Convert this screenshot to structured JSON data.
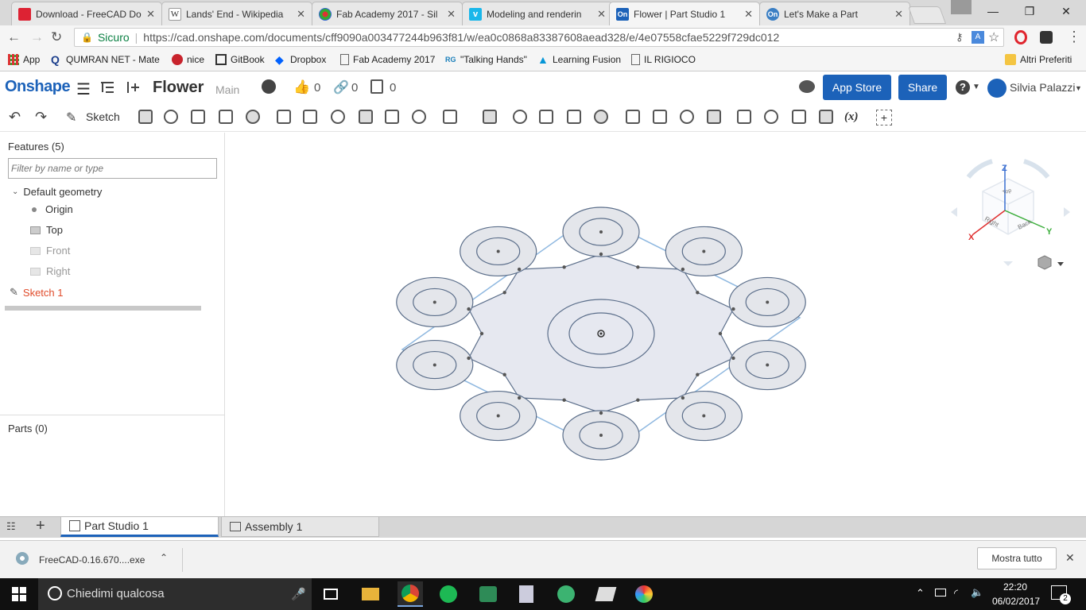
{
  "browser": {
    "tabs": [
      {
        "title": "Download - FreeCAD Do",
        "icon": "freecad-icon",
        "color": "#d23"
      },
      {
        "title": "Lands' End - Wikipedia",
        "icon": "wikipedia-icon",
        "color": "#555"
      },
      {
        "title": "Fab Academy 2017 - Sil",
        "icon": "fabacademy-icon",
        "color": "#d33"
      },
      {
        "title": "Modeling and renderin",
        "icon": "vimeo-icon",
        "color": "#1ab7ea"
      },
      {
        "title": "Flower | Part Studio 1",
        "icon": "onshape-icon",
        "color": "#1c62b9"
      },
      {
        "title": "Let's Make a Part",
        "icon": "onshape-icon",
        "color": "#3b7fc4"
      }
    ],
    "address": {
      "secure_label": "Sicuro",
      "url": "https://cad.onshape.com/documents/cff9090a003477244b963f81/w/ea0c0868a83387608aead328/e/4e07558cfae5229f729dc012"
    },
    "bookmarks": [
      {
        "label": "App",
        "icon": "apps-grid-icon"
      },
      {
        "label": "QUMRAN NET - Mate",
        "icon": "q-icon"
      },
      {
        "label": "nice",
        "icon": "pinterest-icon"
      },
      {
        "label": "GitBook",
        "icon": "gitbook-icon"
      },
      {
        "label": "Dropbox",
        "icon": "dropbox-icon"
      },
      {
        "label": "Fab Academy 2017",
        "icon": "page-icon"
      },
      {
        "label": "\"Talking Hands\"",
        "icon": "rg-icon"
      },
      {
        "label": "Learning Fusion",
        "icon": "autodesk-icon"
      },
      {
        "label": "IL RIGIOCO",
        "icon": "page-icon"
      }
    ],
    "other_bookmarks": "Altri Preferiti"
  },
  "onshape": {
    "logo": "Onshape",
    "doc_title": "Flower",
    "branch": "Main",
    "likes": "0",
    "links": "0",
    "copies": "0",
    "app_store": "App Store",
    "share": "Share",
    "user": "Silvia Palazzi",
    "sketch_label": "Sketch",
    "variable_label": "(x)"
  },
  "features": {
    "header": "Features (5)",
    "filter_placeholder": "Filter by name or type",
    "default_geometry": "Default geometry",
    "origin": "Origin",
    "top": "Top",
    "front": "Front",
    "right": "Right",
    "sketch": "Sketch 1",
    "parts": "Parts (0)"
  },
  "viewcube": {
    "z": "Z",
    "x": "X",
    "y": "Y",
    "right": "Right",
    "back": "Back",
    "top": "Top"
  },
  "bottom_tabs": {
    "part_studio": "Part Studio 1",
    "assembly": "Assembly 1"
  },
  "download": {
    "file": "FreeCAD-0.16.670....exe",
    "show_all": "Mostra tutto"
  },
  "taskbar": {
    "search": "Chiedimi qualcosa",
    "time": "22:20",
    "date": "06/02/2017",
    "notifications": "2"
  },
  "colors": {
    "accent": "#1c62b9",
    "sketch_red": "#e04b2a",
    "sketch_blue": "#8fb8e0"
  }
}
